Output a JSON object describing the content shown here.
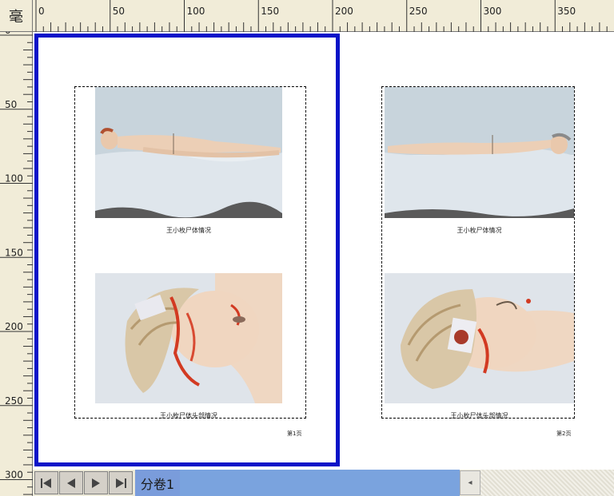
{
  "ruler": {
    "unit_label": "毫",
    "horizontal_labels": [
      "0",
      "50",
      "100",
      "150",
      "200",
      "250",
      "300",
      "350"
    ],
    "vertical_labels": [
      "0",
      "50",
      "100",
      "150",
      "200",
      "250",
      "300"
    ]
  },
  "pages": [
    {
      "captions": [
        "王小枚尸体情况",
        "王小枚尸体头部情况"
      ],
      "page_number": "第1页"
    },
    {
      "captions": [
        "王小枚尸体情况",
        "王小枚尸体头部情况"
      ],
      "page_number": "第2页"
    }
  ],
  "sheet_tab": {
    "label": "分卷1"
  },
  "colors": {
    "selection_border": "#0a14c8",
    "ruler_bg": "#f1ecd8",
    "tab_bg": "#7a9cdb"
  }
}
